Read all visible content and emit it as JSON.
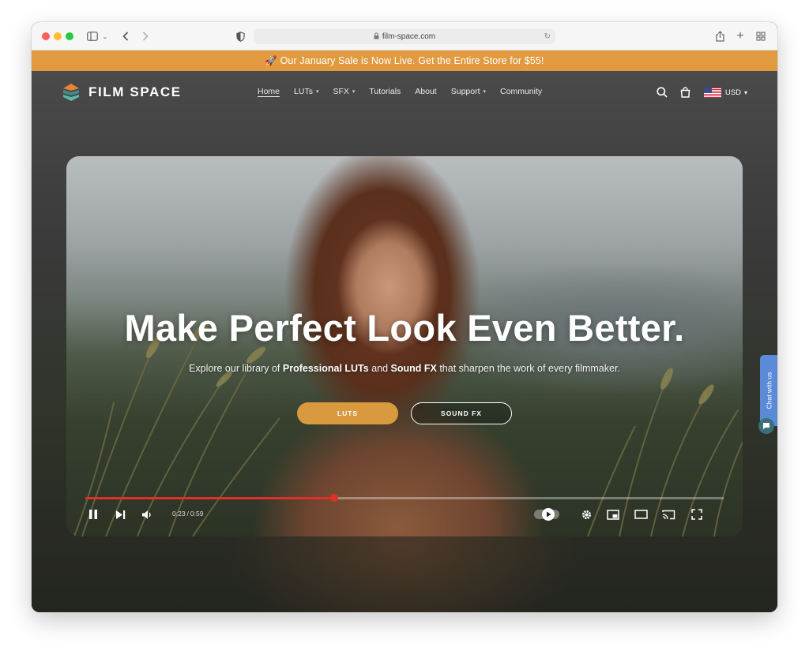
{
  "browser": {
    "url": "film-space.com",
    "icons": [
      "sidebar-icon",
      "chevron-down-icon",
      "back-icon",
      "forward-icon",
      "shield-icon",
      "lock-icon",
      "reload-icon",
      "share-icon",
      "new-tab-icon",
      "tab-overview-icon"
    ]
  },
  "announcement": {
    "text": "Our January Sale is Now Live. Get the Entire Store for $55!",
    "icon": "rocket-icon",
    "background": "#e19a3f"
  },
  "header": {
    "logo_text": "FILM SPACE",
    "nav": [
      {
        "label": "Home",
        "active": true,
        "dropdown": false
      },
      {
        "label": "LUTs",
        "active": false,
        "dropdown": true
      },
      {
        "label": "SFX",
        "active": false,
        "dropdown": true
      },
      {
        "label": "Tutorials",
        "active": false,
        "dropdown": false
      },
      {
        "label": "About",
        "active": false,
        "dropdown": false
      },
      {
        "label": "Support",
        "active": false,
        "dropdown": true
      },
      {
        "label": "Community",
        "active": false,
        "dropdown": false
      }
    ],
    "icons": [
      "search-icon",
      "cart-icon"
    ],
    "currency": "USD"
  },
  "hero": {
    "headline": "Make Perfect Look Even Better.",
    "sub_pre": "Explore our library of ",
    "sub_bold1": "Professional LUTs",
    "sub_mid": " and ",
    "sub_bold2": "Sound FX",
    "sub_post": " that sharpen the work of every filmmaker.",
    "button_primary": "LUTS",
    "button_secondary": "SOUND FX",
    "accent": "#d9993f"
  },
  "player": {
    "current_time": "0:23",
    "duration": "0:59",
    "progress_fraction": 0.3898,
    "progress_color": "#e0302a",
    "icons": [
      "pause-icon",
      "next-icon",
      "volume-icon",
      "autoplay-toggle-icon",
      "settings-icon",
      "miniplayer-icon",
      "theater-icon",
      "cast-icon",
      "fullscreen-icon"
    ]
  },
  "chat": {
    "label": "Chat with us",
    "color": "#5b8bd6"
  }
}
